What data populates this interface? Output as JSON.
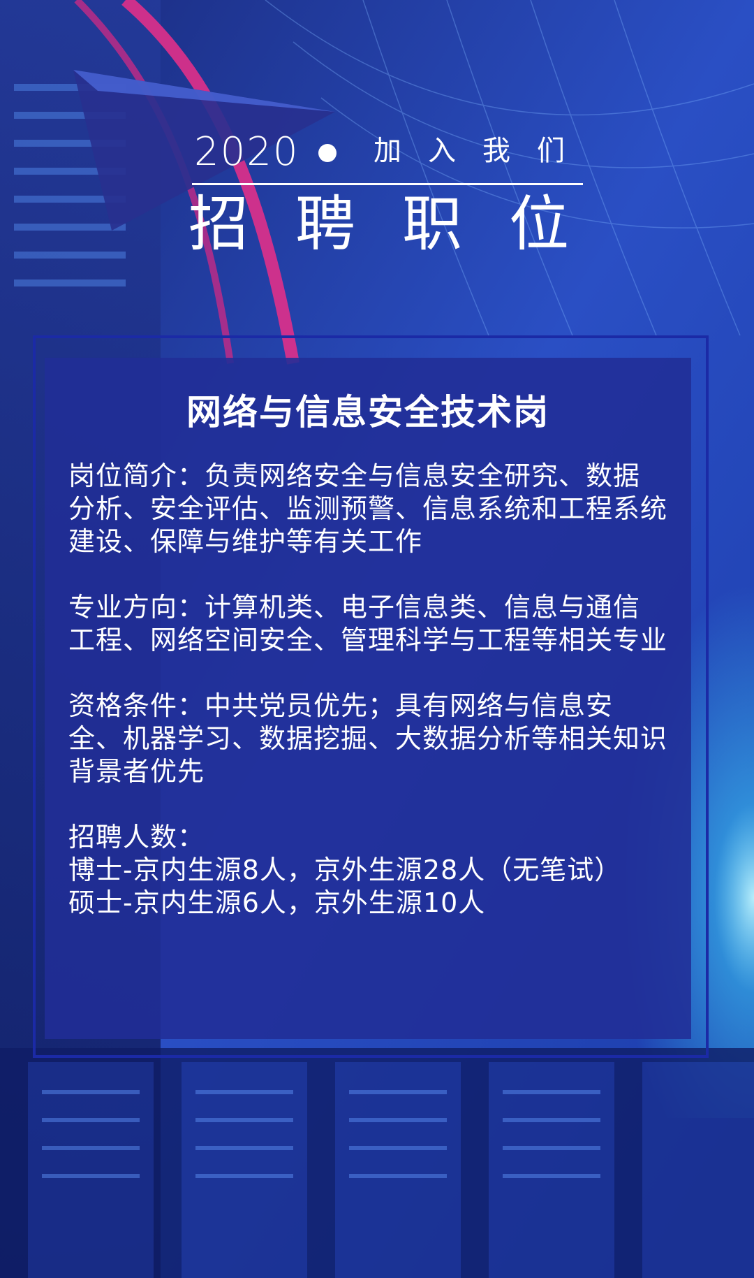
{
  "header": {
    "year": "2020",
    "join_us": "加入我们",
    "title": "招聘职位"
  },
  "position": {
    "title": "网络与信息安全技术岗",
    "intro": {
      "label": "岗位简介：",
      "text": "负责网络安全与信息安全研究、数据分析、安全评估、监测预警、信息系统和工程系统建设、保障与维护等有关工作"
    },
    "major": {
      "label": "专业方向：",
      "text": "计算机类、电子信息类、信息与通信工程、网络空间安全、管理科学与工程等相关专业"
    },
    "qualification": {
      "label": "资格条件：",
      "text": "中共党员优先；具有网络与信息安全、机器学习、数据挖掘、大数据分析等相关知识背景者优先"
    },
    "headcount": {
      "label": "招聘人数：",
      "phd": "博士-京内生源8人，京外生源28人（无笔试）",
      "master": "硕士-京内生源6人，京外生源10人"
    }
  },
  "colors": {
    "background": "#1b2f8f",
    "panel": "#212d96",
    "text": "#ffffff",
    "accent_pink": "#e0308a",
    "accent_cyan": "#3fd8ff"
  }
}
